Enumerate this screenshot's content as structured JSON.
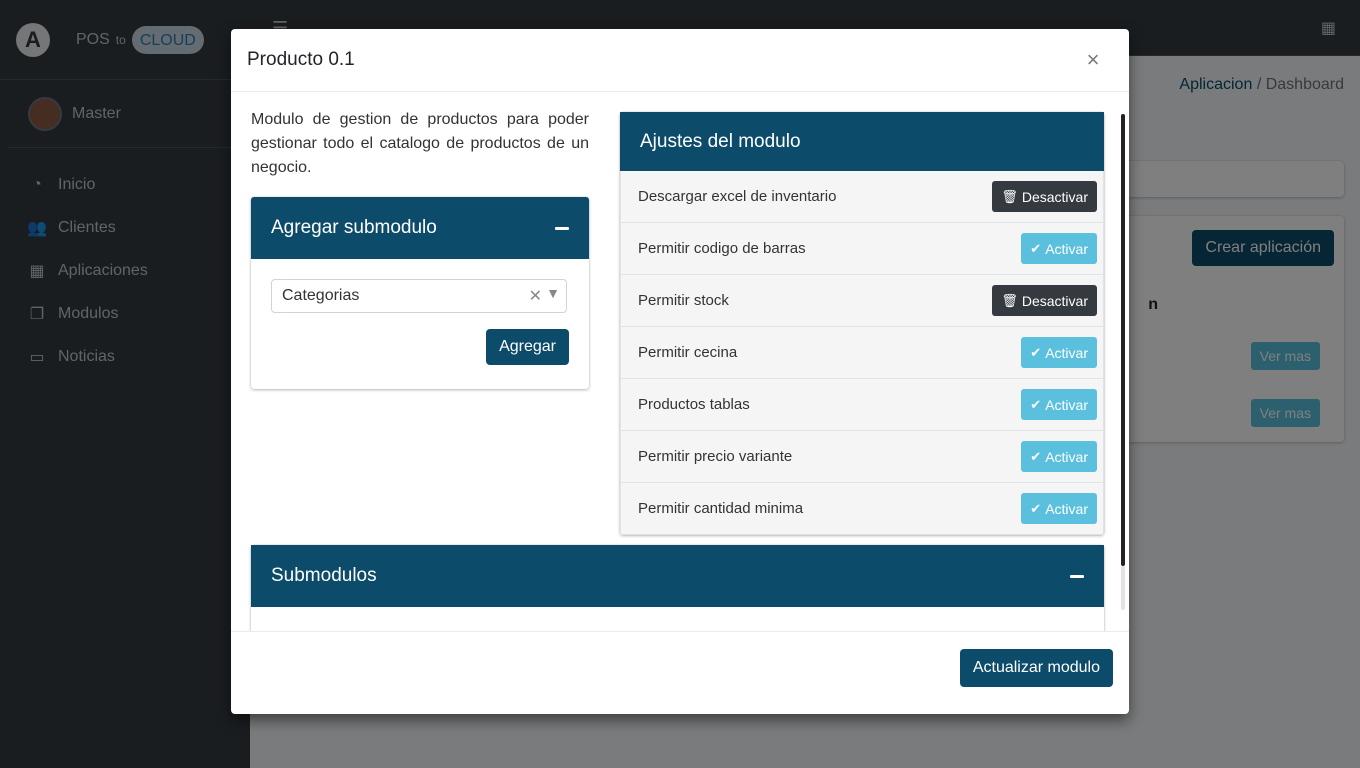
{
  "brand": {
    "logo": "A",
    "pos": "POS",
    "to": "to",
    "cloud": "CLOUD"
  },
  "user": {
    "name": "Master"
  },
  "nav": [
    {
      "icon": "tachometer-icon",
      "glyph": "◔",
      "label": "Inicio"
    },
    {
      "icon": "users-icon",
      "glyph": "👥",
      "label": "Clientes"
    },
    {
      "icon": "grid-icon",
      "glyph": "▦",
      "label": "Aplicaciones"
    },
    {
      "icon": "copy-icon",
      "glyph": "❐",
      "label": "Modulos"
    },
    {
      "icon": "comment-icon",
      "glyph": "▭",
      "label": "Noticias"
    }
  ],
  "breadcrumb": {
    "first": "Aplicacion",
    "separator": "/",
    "second": "Dashboard"
  },
  "background": {
    "create_button": "Crear aplicación",
    "view_button": "Ver mas",
    "table_header_fragment": "n"
  },
  "modal": {
    "title": "Producto 0.1",
    "close": "×",
    "description": "Modulo de gestion de productos para poder gestionar todo el catalogo de productos de un negocio.",
    "add_submodule": {
      "title": "Agregar submodulo",
      "select_value": "Categorias",
      "button": "Agregar"
    },
    "settings": {
      "title": "Ajustes del modulo",
      "rows": [
        {
          "label": "Descargar excel de inventario",
          "action": "Desactivar",
          "state": "desactivar"
        },
        {
          "label": "Permitir codigo de barras",
          "action": "Activar",
          "state": "activar"
        },
        {
          "label": "Permitir stock",
          "action": "Desactivar",
          "state": "desactivar"
        },
        {
          "label": "Permitir cecina",
          "action": "Activar",
          "state": "activar"
        },
        {
          "label": "Productos tablas",
          "action": "Activar",
          "state": "activar"
        },
        {
          "label": "Permitir precio variante",
          "action": "Activar",
          "state": "activar"
        },
        {
          "label": "Permitir cantidad minima",
          "action": "Activar",
          "state": "activar"
        }
      ]
    },
    "submodules": {
      "title": "Submodulos"
    },
    "footer_button": "Actualizar modulo"
  },
  "colors": {
    "primary": "#0c4b6a",
    "activar": "#5bc0de",
    "desactivar": "#343a40"
  }
}
